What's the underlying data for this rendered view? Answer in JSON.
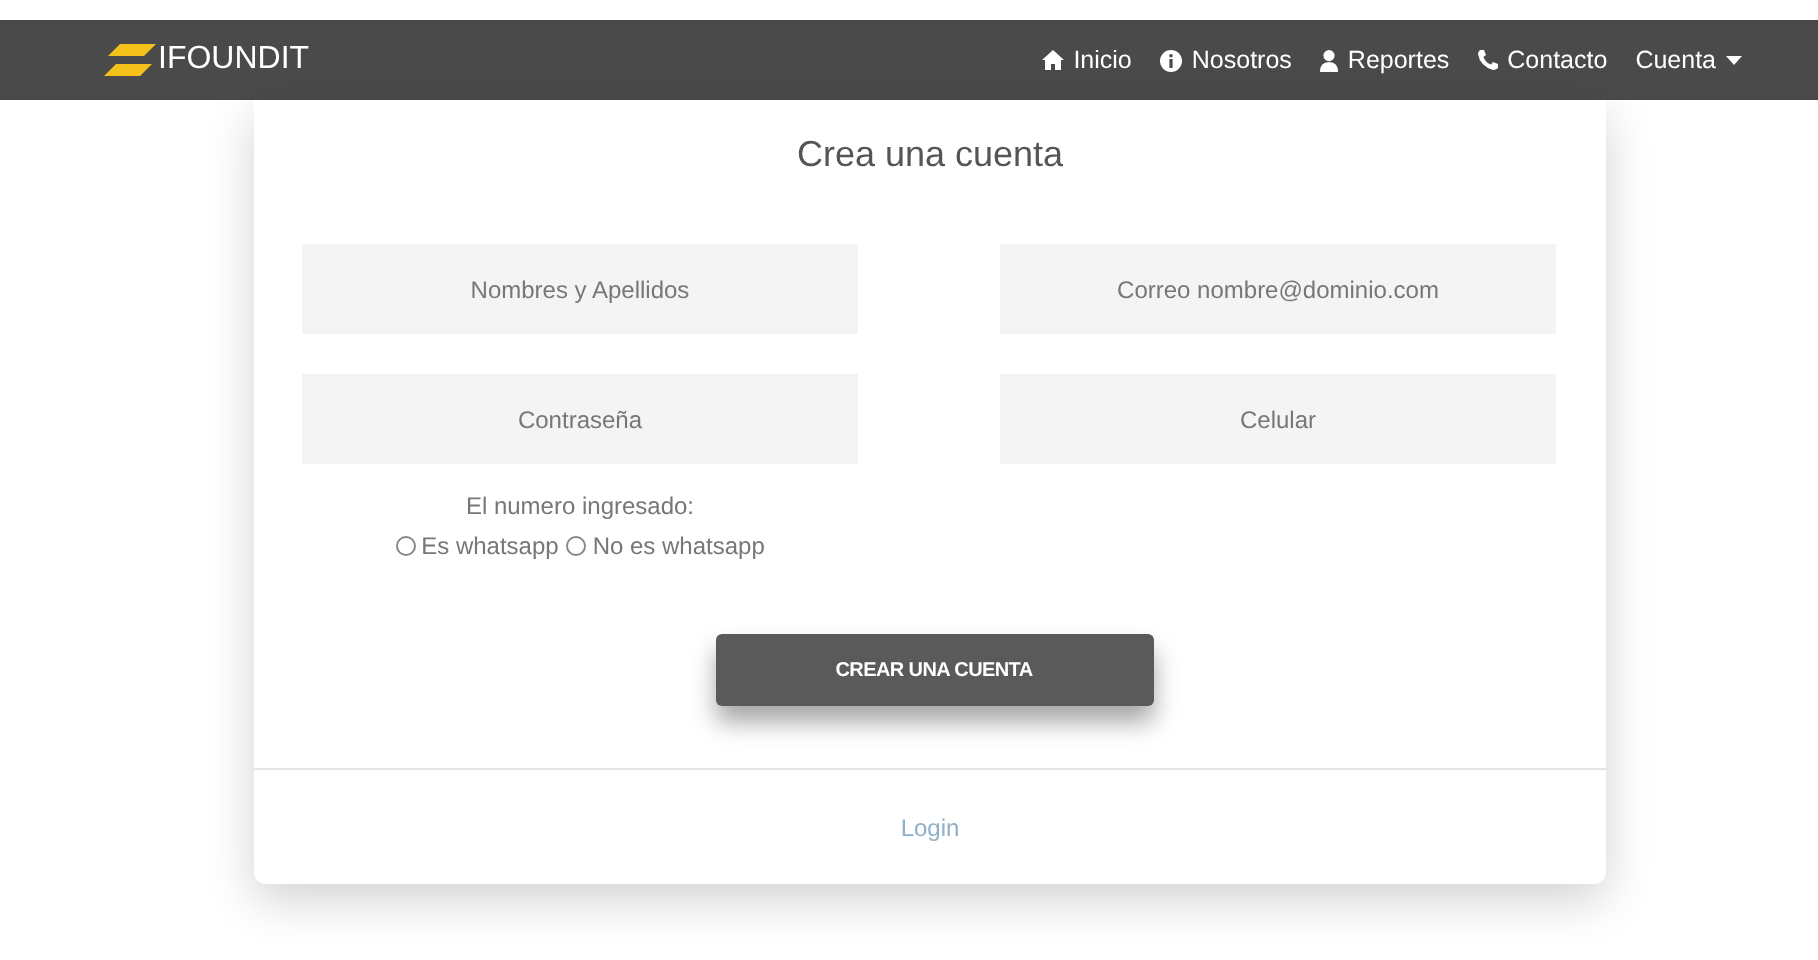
{
  "navbar": {
    "brand": "IFOUNDIT",
    "items": [
      {
        "label": "Inicio",
        "kind": "home"
      },
      {
        "label": "Nosotros",
        "kind": "info"
      },
      {
        "label": "Reportes",
        "kind": "user"
      },
      {
        "label": "Contacto",
        "kind": "phone"
      },
      {
        "label": "Cuenta",
        "kind": "dropdown"
      }
    ]
  },
  "form": {
    "title": "Crea una cuenta",
    "fields": [
      {
        "placeholder": "Nombres y Apellidos"
      },
      {
        "placeholder": "Correo nombre@dominio.com"
      },
      {
        "placeholder": "Contraseña"
      },
      {
        "placeholder": "Celular"
      }
    ],
    "whatsapp_label": "El numero ingresado:",
    "options": [
      {
        "label": "Es whatsapp",
        "selected": false
      },
      {
        "label": "No es whatsapp",
        "selected": false
      }
    ],
    "submit": "CREAR UNA CUENTA",
    "login_link": "Login"
  }
}
